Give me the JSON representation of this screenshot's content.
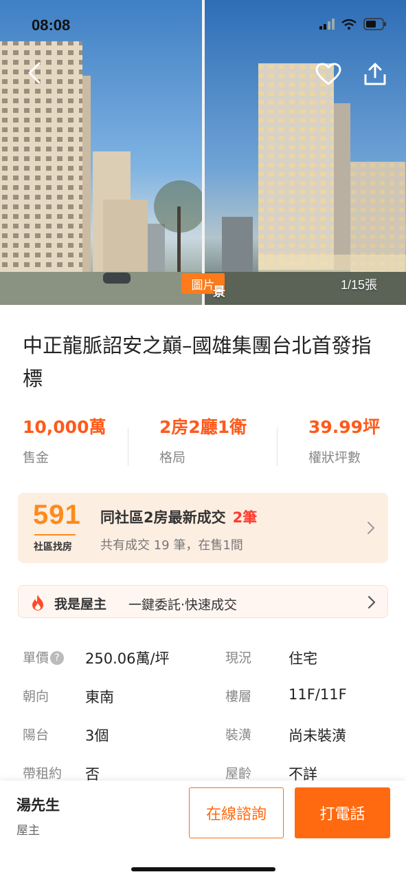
{
  "status_bar": {
    "time": "08:08"
  },
  "gallery": {
    "tag": "圖片",
    "counter": "1/15張",
    "left_caption": "",
    "right_caption": "景"
  },
  "title": "中正龍脈詔安之巔–國雄集團台北首發指標",
  "facts": [
    {
      "value": "10,000萬",
      "label": "售金"
    },
    {
      "value": "2房2廳1衛",
      "label": "格局"
    },
    {
      "value": "39.99坪",
      "label": "權狀坪數"
    }
  ],
  "community": {
    "logo_number": "591",
    "logo_sub": "社區找房",
    "title": "同社區2房最新成交",
    "title_count": "2筆",
    "subtitle": "共有成交 19 筆，在售1間"
  },
  "owner_banner": {
    "title": "我是屋主",
    "subtitle": "一鍵委託·快速成交"
  },
  "details": [
    {
      "k1": "單價",
      "v1": "250.06萬/坪",
      "k2": "現況",
      "v2": "住宅"
    },
    {
      "k1": "朝向",
      "v1": "東南",
      "k2": "樓層",
      "v2": "11F/11F"
    },
    {
      "k1": "陽台",
      "v1": "3個",
      "k2": "裝潢",
      "v2": "尚未裝潢"
    },
    {
      "k1": "帶租約",
      "v1": "否",
      "k2": "屋齡",
      "v2": "不詳"
    }
  ],
  "help_icon_glyph": "?",
  "contact": {
    "name": "湯先生",
    "role": "屋主",
    "consult_label": "在線諮詢",
    "call_label": "打電話"
  },
  "colors": {
    "accent": "#ff6a10",
    "price": "#ff5a1a",
    "count_red": "#ff3b2f"
  }
}
